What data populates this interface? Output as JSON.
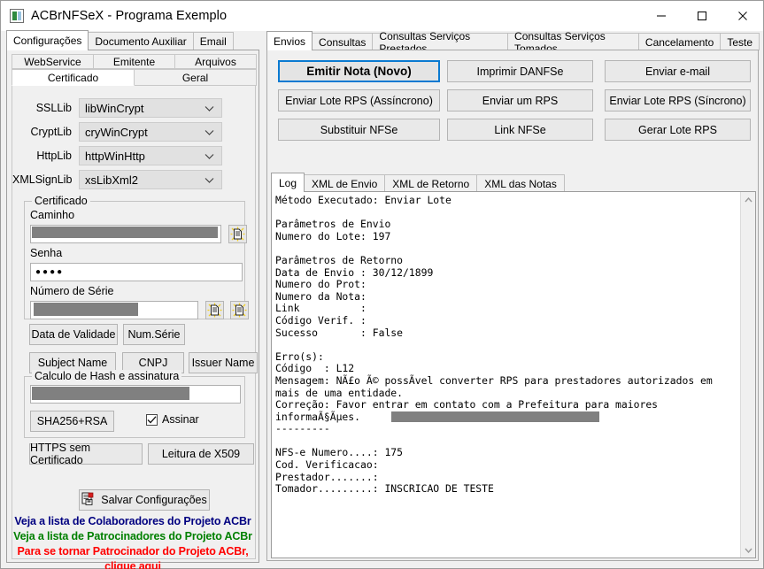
{
  "window": {
    "title": "ACBrNFSeX - Programa Exemplo",
    "minimize_label": "—",
    "maximize_label": "□",
    "close_label": "✕"
  },
  "left": {
    "outer_tabs": [
      {
        "label": "Configurações",
        "active": true
      },
      {
        "label": "Documento Auxiliar",
        "active": false
      },
      {
        "label": "Email",
        "active": false
      }
    ],
    "sub_tabs_row1": [
      {
        "label": "WebService"
      },
      {
        "label": "Emitente"
      },
      {
        "label": "Arquivos"
      }
    ],
    "sub_tabs_row2": [
      {
        "label": "Certificado",
        "active": true
      },
      {
        "label": "Geral",
        "active": false
      }
    ],
    "libs": [
      {
        "label": "SSLLib",
        "value": "libWinCrypt"
      },
      {
        "label": "CryptLib",
        "value": "cryWinCrypt"
      },
      {
        "label": "HttpLib",
        "value": "httpWinHttp"
      },
      {
        "label": "XMLSignLib",
        "value": "xsLibXml2"
      }
    ],
    "certificado": {
      "group_title": "Certificado",
      "caminho_label": "Caminho",
      "caminho_value": "",
      "senha_label": "Senha",
      "senha_value": "●●●●",
      "numero_serie_label": "Número de Série",
      "numero_serie_value": ""
    },
    "cert_buttons": [
      {
        "label": "Data de Validade"
      },
      {
        "label": "Num.Série"
      },
      {
        "label": "Subject Name"
      },
      {
        "label": "CNPJ"
      },
      {
        "label": "Issuer Name"
      }
    ],
    "hash": {
      "group_title": "Calculo de Hash e assinatura",
      "value": "",
      "button_label": "SHA256+RSA",
      "checkbox_label": "Assinar",
      "checkbox_checked": true
    },
    "bottom_buttons": [
      {
        "label": "HTTPS sem Certificado"
      },
      {
        "label": "Leitura de X509"
      }
    ],
    "save_button_label": "Salvar Configurações",
    "links": [
      {
        "text": "Veja a lista de Colaboradores do Projeto ACBr",
        "color": "#000080"
      },
      {
        "text": "Veja a lista de Patrocinadores do Projeto ACBr",
        "color": "#008000"
      },
      {
        "text": "Para se tornar Patrocinador do Projeto ACBr,",
        "color": "#FF0000"
      },
      {
        "text": "clique aqui",
        "color": "#FF0000"
      }
    ]
  },
  "right": {
    "tabs": [
      {
        "label": "Envios",
        "active": true
      },
      {
        "label": "Consultas",
        "active": false
      },
      {
        "label": "Consultas Serviços Prestados",
        "active": false
      },
      {
        "label": "Consultas Serviços Tomados",
        "active": false
      },
      {
        "label": "Cancelamento",
        "active": false
      },
      {
        "label": "Teste",
        "active": false
      }
    ],
    "action_buttons": [
      {
        "label": "Emitir Nota (Novo)",
        "focused": true
      },
      {
        "label": "Imprimir DANFSe",
        "focused": false
      },
      {
        "label": "Enviar e-mail",
        "focused": false
      },
      {
        "label": "Enviar Lote RPS (Assíncrono)",
        "focused": false
      },
      {
        "label": "Enviar um RPS",
        "focused": false
      },
      {
        "label": "Enviar Lote RPS (Síncrono)",
        "focused": false
      },
      {
        "label": "Substituir NFSe",
        "focused": false
      },
      {
        "label": "Link NFSe",
        "focused": false
      },
      {
        "label": "Gerar Lote RPS",
        "focused": false
      }
    ],
    "log_tabs": [
      {
        "label": "Log",
        "active": true
      },
      {
        "label": "XML de Envio",
        "active": false
      },
      {
        "label": "XML de Retorno",
        "active": false
      },
      {
        "label": "XML das Notas",
        "active": false
      }
    ],
    "log_text": "Método Executado: Enviar Lote\n\nParâmetros de Envio\nNumero do Lote: 197\n\nParâmetros de Retorno\nData de Envio : 30/12/1899\nNumero do Prot:\nNumero da Nota:\nLink          :\nCódigo Verif. :\nSucesso       : False\n\nErro(s):\nCódigo  : L12\nMensagem: NÃ£o Ã© possÃ­vel converter RPS para prestadores autorizados em\nmais de uma entidade.\nCorreção: Favor entrar em contato com a Prefeitura para maiores\ninformaÃ§Ãµes.\n---------\n\nNFS-e Numero....: 175\nCod. Verificacao:\nPrestador.......:\nTomador.........: INSCRICAO DE TESTE"
  }
}
